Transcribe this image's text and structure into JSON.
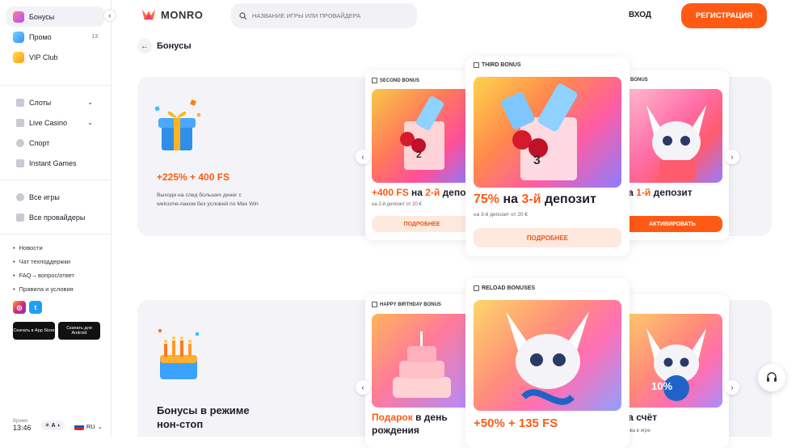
{
  "sidebar": {
    "top_items": [
      {
        "label": "Бонусы",
        "icon": "gift-icon"
      },
      {
        "label": "Промо",
        "icon": "promo-icon",
        "badge": "13"
      },
      {
        "label": "VIP Club",
        "icon": "crown-icon"
      }
    ],
    "nav_items": [
      {
        "label": "Слоты",
        "icon": "slots-icon"
      },
      {
        "label": "Live Casino",
        "icon": "live-icon"
      },
      {
        "label": "Спорт",
        "icon": "sport-icon"
      },
      {
        "label": "Instant Games",
        "icon": "chart-icon"
      }
    ],
    "cat_items": [
      {
        "label": "Все игры",
        "icon": "all-games-icon"
      },
      {
        "label": "Все провайдеры",
        "icon": "providers-icon"
      }
    ],
    "links": [
      "Новости",
      "Чат техподдержки",
      "FAQ – вопрос/ответ",
      "Правила и условия"
    ],
    "app_store": "Скачать в App Store",
    "android": "Скачать для Android",
    "time_label": "Время",
    "time_value": "13:46",
    "theme_label": "A",
    "lang": "RU"
  },
  "header": {
    "logo": "MONRO",
    "search_placeholder": "НАЗВАНИЕ ИГРЫ ИЛИ ПРОВАЙДЕРА",
    "login": "ВХОД",
    "register": "РЕГИСТРАЦИЯ"
  },
  "page": {
    "title": "Бонусы"
  },
  "section1": {
    "title": "+225% + 400 FS",
    "description": "Выходи на след больших денег с welcome-паком без условий по Max Win",
    "cards": [
      {
        "label": "SECOND BONUS",
        "title_accent_1": "+400 FS",
        "title_mid": " на ",
        "title_accent_2": "2-й",
        "title_rest": " депозит",
        "sub": "на 2-й депозит от 20 €",
        "button": "ПОДРОБНЕЕ"
      },
      {
        "label": "THIRD BONUS",
        "title_accent_1": "75%",
        "title_mid": " на ",
        "title_accent_2": "3-й",
        "title_rest": " депозит",
        "sub": "на 3-й депозит от 20 €",
        "button": "ПОДРОБНЕЕ"
      },
      {
        "label": "BONUS",
        "title_mid": "на ",
        "title_accent_2": "1-й",
        "title_rest": " депозит",
        "button": "АКТИВИРОВАТЬ"
      }
    ]
  },
  "section2": {
    "title": "Бонусы в режиме нон-стоп",
    "cards": [
      {
        "label": "HAPPY BIRTHDAY BONUS",
        "title_accent": "Подарок",
        "title_rest": " в день рождения"
      },
      {
        "label": "RELOAD BONUSES",
        "title_accent": "+50% + 135 FS"
      },
      {
        "title_rest": "на счёт",
        "sub": "снова в игре",
        "badge": "10%"
      }
    ]
  },
  "colors": {
    "accent": "#ff5a14",
    "soft_accent": "#ffe8dd",
    "panel": "#f4f4f8"
  }
}
